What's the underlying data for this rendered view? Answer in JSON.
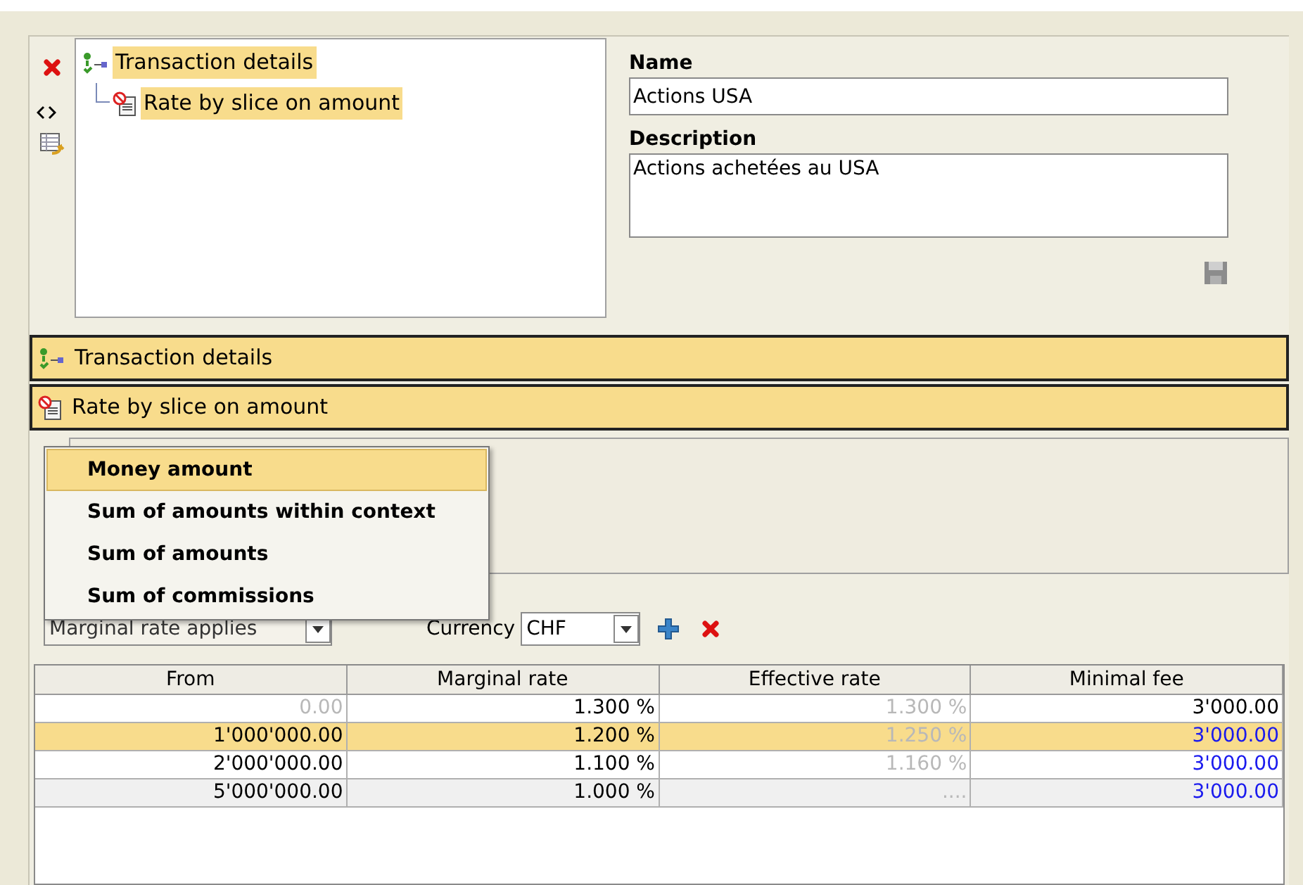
{
  "tree": [
    {
      "label": "Transaction details",
      "kind": "group",
      "selected": true,
      "children": [
        {
          "label": "Rate by slice on amount",
          "kind": "rate",
          "selected": true
        }
      ]
    }
  ],
  "form": {
    "name_label": "Name",
    "name_value": "Actions USA",
    "description_label": "Description",
    "description_value": "Actions achetées au USA"
  },
  "sections": [
    {
      "label": "Transaction details",
      "kind": "group"
    },
    {
      "label": "Rate by slice on amount",
      "kind": "rate"
    }
  ],
  "dropdown_menu": [
    {
      "label": "Money amount",
      "selected": true
    },
    {
      "label": "Sum of amounts within context",
      "selected": false
    },
    {
      "label": "Sum of amounts",
      "selected": false
    },
    {
      "label": "Sum of commissions",
      "selected": false
    }
  ],
  "mode_combo": {
    "value": "Marginal rate applies"
  },
  "currency": {
    "label": "Currency",
    "value": "CHF"
  },
  "table": {
    "columns": [
      "From",
      "Marginal rate",
      "Effective rate",
      "Minimal fee"
    ],
    "rows": [
      {
        "selected": false,
        "shaded": false,
        "cells": [
          {
            "text": "0.00",
            "kind": "dimmed"
          },
          {
            "text": "1.300 %",
            "kind": "normal"
          },
          {
            "text": "1.300 %",
            "kind": "dimmed"
          },
          {
            "text": "3'000.00",
            "kind": "normal"
          }
        ]
      },
      {
        "selected": true,
        "shaded": false,
        "cells": [
          {
            "text": "1'000'000.00",
            "kind": "normal"
          },
          {
            "text": "1.200 %",
            "kind": "normal"
          },
          {
            "text": "1.250 %",
            "kind": "dimmed"
          },
          {
            "text": "3'000.00",
            "kind": "inherited"
          }
        ]
      },
      {
        "selected": false,
        "shaded": false,
        "cells": [
          {
            "text": "2'000'000.00",
            "kind": "normal"
          },
          {
            "text": "1.100 %",
            "kind": "normal"
          },
          {
            "text": "1.160 %",
            "kind": "dimmed"
          },
          {
            "text": "3'000.00",
            "kind": "inherited"
          }
        ]
      },
      {
        "selected": false,
        "shaded": true,
        "cells": [
          {
            "text": "5'000'000.00",
            "kind": "normal"
          },
          {
            "text": "1.000 %",
            "kind": "normal"
          },
          {
            "text": "....",
            "kind": "dimmed"
          },
          {
            "text": "3'000.00",
            "kind": "inherited"
          }
        ]
      }
    ]
  }
}
